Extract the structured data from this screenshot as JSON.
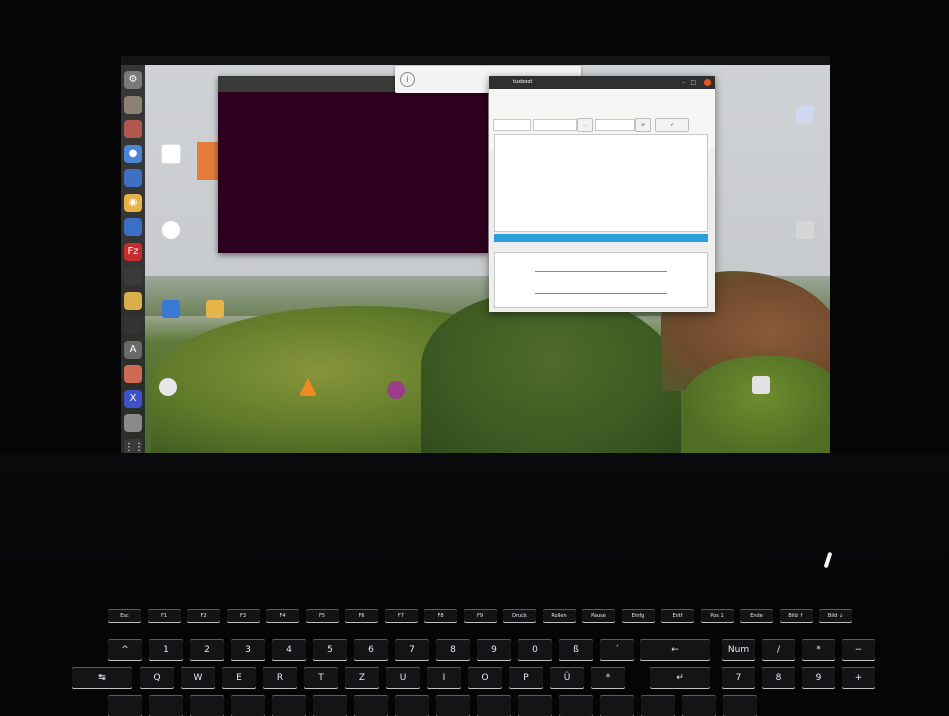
{
  "topbar": {
    "activities": "",
    "app_menu": "",
    "clock": "",
    "status": ""
  },
  "dock": {
    "icons": [
      {
        "name": "settings-icon",
        "color": "#7a7a7a",
        "glyph": "⚙"
      },
      {
        "name": "files-icon",
        "color": "#8b8175",
        "glyph": ""
      },
      {
        "name": "folder-icon",
        "color": "#b0584e",
        "glyph": ""
      },
      {
        "name": "chrome-icon",
        "color": "#4b86d6",
        "glyph": "●"
      },
      {
        "name": "thunderbird-icon",
        "color": "#3e6fc2",
        "glyph": ""
      },
      {
        "name": "rhythmbox-icon",
        "color": "#e6b24a",
        "glyph": "◉"
      },
      {
        "name": "writer-icon",
        "color": "#3b6fc6",
        "glyph": ""
      },
      {
        "name": "filezilla-icon",
        "color": "#c62d2d",
        "glyph": "Fz"
      },
      {
        "name": "usb-icon",
        "color": "#3a3a3a",
        "glyph": ""
      },
      {
        "name": "image-viewer-icon",
        "color": "#d7b04b",
        "glyph": ""
      },
      {
        "name": "terminal-icon",
        "color": "#333333",
        "glyph": ""
      },
      {
        "name": "software-icon",
        "color": "#6a6a6a",
        "glyph": "A"
      },
      {
        "name": "disks-icon",
        "color": "#d06a52",
        "glyph": ""
      },
      {
        "name": "xmind-icon",
        "color": "#3c52c8",
        "glyph": "X"
      },
      {
        "name": "drive-icon",
        "color": "#8a8a8a",
        "glyph": ""
      },
      {
        "name": "show-applications-icon",
        "color": "#3a3a3a",
        "glyph": "⋮⋮"
      }
    ]
  },
  "desktop": {
    "icons": [
      {
        "name": "desktop-icon-app",
        "label": "",
        "color": "#d94b6f"
      },
      {
        "name": "desktop-icon-orange",
        "label": "",
        "color": "#e47a3c"
      },
      {
        "name": "desktop-icon-chrome",
        "label": "",
        "color": "#3f7bd0"
      },
      {
        "name": "desktop-icon-shortcut",
        "label": "",
        "color": "#3a78d4"
      },
      {
        "name": "desktop-icon-paint",
        "label": "",
        "color": "#e5b54a"
      },
      {
        "name": "desktop-icon-360",
        "label": "",
        "color": "#e6e6e6"
      },
      {
        "name": "desktop-icon-vlc",
        "label": "",
        "color": "#f08a1f"
      },
      {
        "name": "desktop-icon-document",
        "label": "",
        "color": "#9b3d8a"
      },
      {
        "name": "desktop-icon-trash",
        "label": "",
        "color": "#e2e2e2"
      },
      {
        "name": "desktop-icon-pdf",
        "label": "",
        "color": "#d0d8f0"
      },
      {
        "name": "desktop-icon-folder-right",
        "label": "",
        "color": "#d6d6d6"
      }
    ]
  },
  "terminal": {
    "title": "",
    "prompt_user": "",
    "prompt_rest": ""
  },
  "notification": {
    "title": "",
    "body": ""
  },
  "tuxboot": {
    "title": "tuxboot",
    "ok_label": "",
    "progress_label": "",
    "panel1_header": "",
    "panel1_lines": [
      "",
      "",
      "",
      "",
      "",
      ""
    ],
    "panel2_header": "",
    "panel2_lines": [
      "",
      "",
      "",
      ""
    ]
  },
  "keyboard": {
    "fkeys": [
      "Esc",
      "F1",
      "F2",
      "F3",
      "F4",
      "F5",
      "F6",
      "F7",
      "F8",
      "F9",
      "Druck",
      "Rollen",
      "Pause",
      "Einfg",
      "Entf",
      "Pos 1",
      "Ende",
      "Bild ↑",
      "Bild ↓"
    ],
    "row1": [
      "^",
      "1",
      "2",
      "3",
      "4",
      "5",
      "6",
      "7",
      "8",
      "9",
      "0",
      "ß",
      "´"
    ],
    "row2": [
      "Q",
      "W",
      "E",
      "R",
      "T",
      "Z",
      "U",
      "I",
      "O",
      "P",
      "Ü",
      "*"
    ],
    "numpad1": [
      "Num",
      "/",
      "*",
      "−"
    ],
    "numpad2": [
      "7",
      "8",
      "9"
    ]
  }
}
